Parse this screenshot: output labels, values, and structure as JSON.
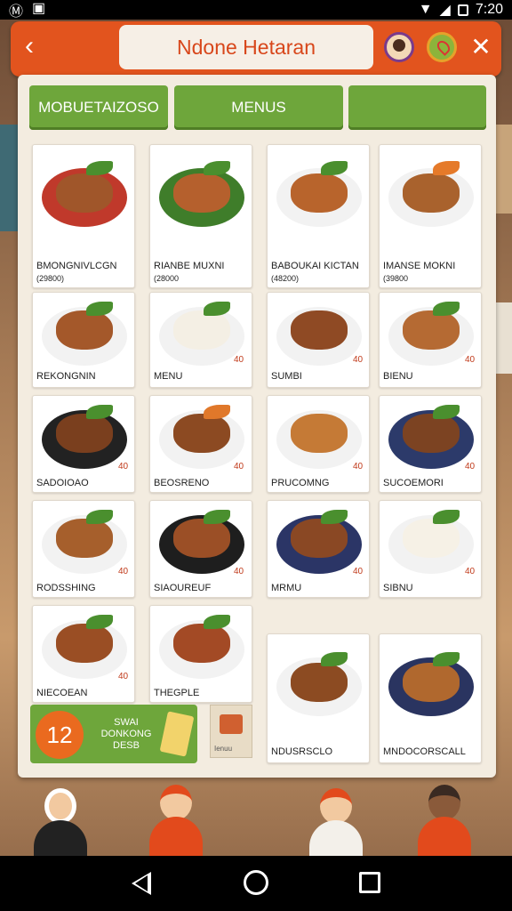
{
  "status_bar": {
    "time": "7:20",
    "icons": [
      "m-icon",
      "image-icon",
      "wifi-icon",
      "signal-icon",
      "battery-icon"
    ]
  },
  "header": {
    "title": "Ndone Hetaran"
  },
  "tabs": [
    {
      "label": "MOBUETAIZOSO"
    },
    {
      "label": "MENUS"
    },
    {
      "label": ""
    }
  ],
  "menu_items": [
    {
      "name": "BMONGNIVLCGN",
      "code": "(29800)"
    },
    {
      "name": "RIANBE MUXNI",
      "code": "(28000"
    },
    {
      "name": "BABOUKAI KICTAN",
      "code": "(48200)"
    },
    {
      "name": "IMANSE MOKNI",
      "code": "(39800"
    },
    {
      "name": "REKONGNIN",
      "price": ""
    },
    {
      "name": "MENU",
      "price": "40"
    },
    {
      "name": "SUMBI",
      "price": "40"
    },
    {
      "name": "BIENU",
      "price": "40"
    },
    {
      "name": "SADOIOAO",
      "price": "40"
    },
    {
      "name": "BEOSRENO",
      "price": "40"
    },
    {
      "name": "PRUCOMNG",
      "price": "40"
    },
    {
      "name": "SUCOEMORI",
      "price": "40"
    },
    {
      "name": "RODSSHING",
      "price": "40"
    },
    {
      "name": "SIAOUREUF",
      "price": "40"
    },
    {
      "name": "MRMU",
      "price": "40"
    },
    {
      "name": "SIBNU",
      "price": "40"
    },
    {
      "name": "NIECOEAN",
      "price": "40"
    },
    {
      "name": "THEGPLE",
      "price": ""
    },
    {
      "name": "NDUSRSCLO",
      "price": ""
    },
    {
      "name": "MNDOCORSCALL",
      "price": ""
    }
  ],
  "promo": {
    "badge": "12",
    "line1": "SWAI",
    "line2": "DONKONG",
    "line3": "DESB"
  },
  "small_card": {
    "caption": "Ienuu"
  },
  "colors": {
    "accent": "#e2541e",
    "tab_green": "#6ea63b",
    "panel": "#f3ece0"
  }
}
